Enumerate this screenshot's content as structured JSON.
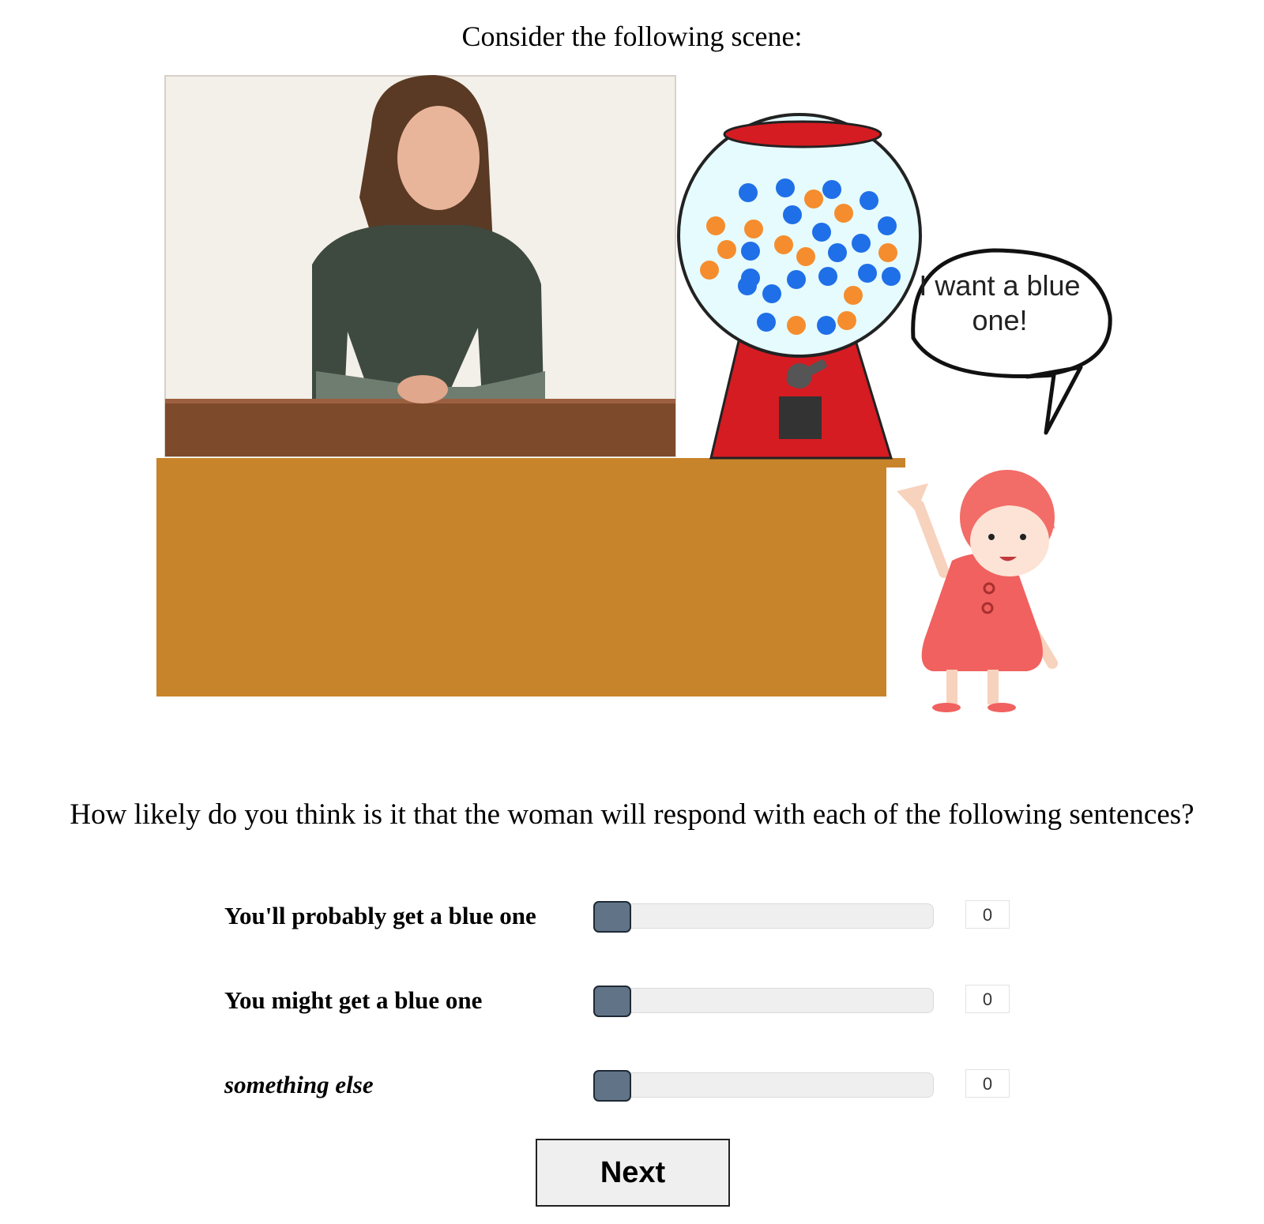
{
  "page": {
    "title": "Consider the following scene:",
    "question": "How likely do you think is it that the woman will respond with each of the following sentences?"
  },
  "scene": {
    "speech_bubble": "I want a blue one!",
    "gumball_colors": {
      "blue": "#1f6fe8",
      "orange": "#f58d2e"
    },
    "counter_color": "#c8842a",
    "machine_color": "#d51c22"
  },
  "responses": [
    {
      "label": "You'll probably get a blue one",
      "value": "0",
      "italic": false
    },
    {
      "label": "You might get a blue one",
      "value": "0",
      "italic": false
    },
    {
      "label": "something else",
      "value": "0",
      "italic": true
    }
  ],
  "next_label": "Next"
}
